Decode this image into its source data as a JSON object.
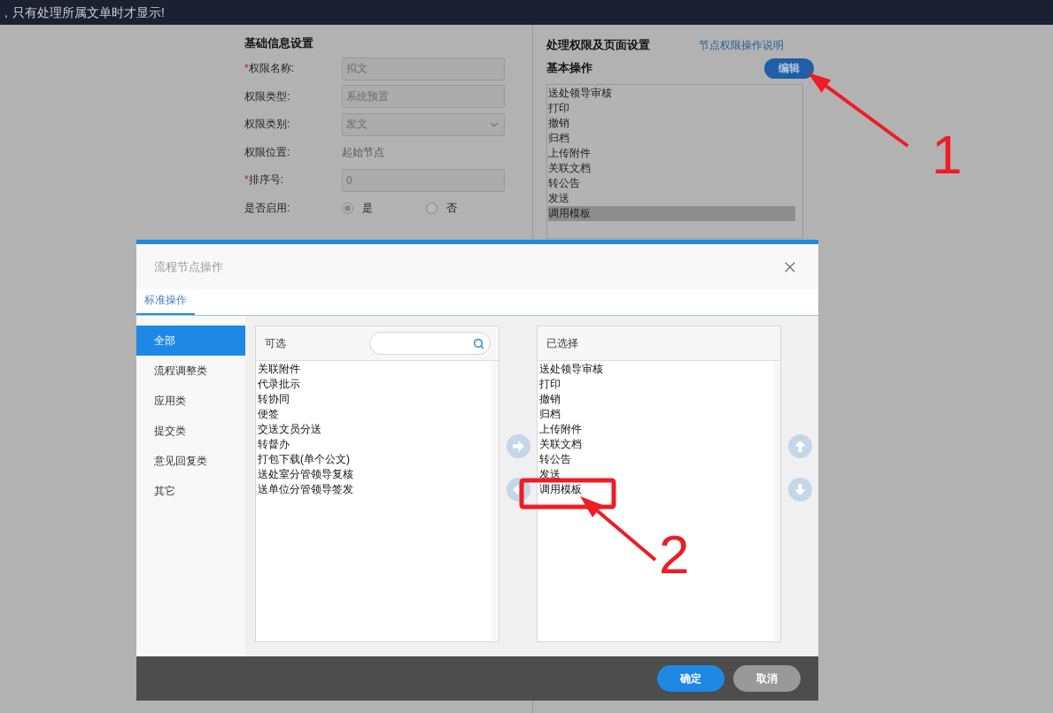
{
  "notice": {
    "text": "，只有处理所属文单时才显示!"
  },
  "form": {
    "title": "基础信息设置",
    "fields": [
      {
        "kind": "input",
        "label": "权限名称:",
        "required_mark": "*",
        "value": "拟文"
      },
      {
        "kind": "input",
        "label": "权限类型:",
        "value": "系统预置"
      },
      {
        "kind": "select",
        "label": "权限类别:",
        "value": "发文"
      },
      {
        "kind": "text",
        "label": "权限位置:",
        "value": "起始节点"
      },
      {
        "kind": "input",
        "label": "排序号:",
        "required_mark": "*",
        "value": "0"
      },
      {
        "kind": "radio",
        "label": "是否启用:",
        "options": [
          {
            "label": "是",
            "selected": true
          },
          {
            "label": "否",
            "selected": false
          }
        ]
      }
    ]
  },
  "permissions": {
    "title": "处理权限及页面设置",
    "help_link": "节点权限操作说明",
    "section": "基本操作",
    "edit_button": "编辑",
    "items": [
      {
        "label": "送处领导审核",
        "selected": false
      },
      {
        "label": "打印",
        "selected": false
      },
      {
        "label": "撤销",
        "selected": false
      },
      {
        "label": "归档",
        "selected": false
      },
      {
        "label": "上传附件",
        "selected": false
      },
      {
        "label": "关联文档",
        "selected": false
      },
      {
        "label": "转公告",
        "selected": false
      },
      {
        "label": "发送",
        "selected": false
      },
      {
        "label": "调用模板",
        "selected": true
      }
    ]
  },
  "dialog": {
    "title": "流程节点操作",
    "tabs": [
      {
        "label": "标准操作",
        "selected": true
      }
    ],
    "categories": [
      {
        "label": "全部",
        "selected": true
      },
      {
        "label": "流程调整类",
        "selected": false
      },
      {
        "label": "应用类",
        "selected": false
      },
      {
        "label": "提交类",
        "selected": false
      },
      {
        "label": "意见回复类",
        "selected": false
      },
      {
        "label": "其它",
        "selected": false
      }
    ],
    "available": {
      "title": "可选",
      "items": [
        "关联附件",
        "代录批示",
        "转协同",
        "便签",
        "交送文员分送",
        "转督办",
        "打包下载(单个公文)",
        "送处室分管领导复核",
        "送单位分管领导签发"
      ]
    },
    "chosen": {
      "title": "已选择",
      "items": [
        "送处领导审核",
        "打印",
        "撤销",
        "归档",
        "上传附件",
        "关联文档",
        "转公告",
        "发送",
        "调用模板"
      ]
    },
    "buttons": [
      {
        "label": "确定",
        "kind": "primary"
      },
      {
        "label": "取消",
        "kind": "secondary"
      }
    ]
  },
  "annotations": [
    {
      "label": "1"
    },
    {
      "label": "2"
    }
  ]
}
